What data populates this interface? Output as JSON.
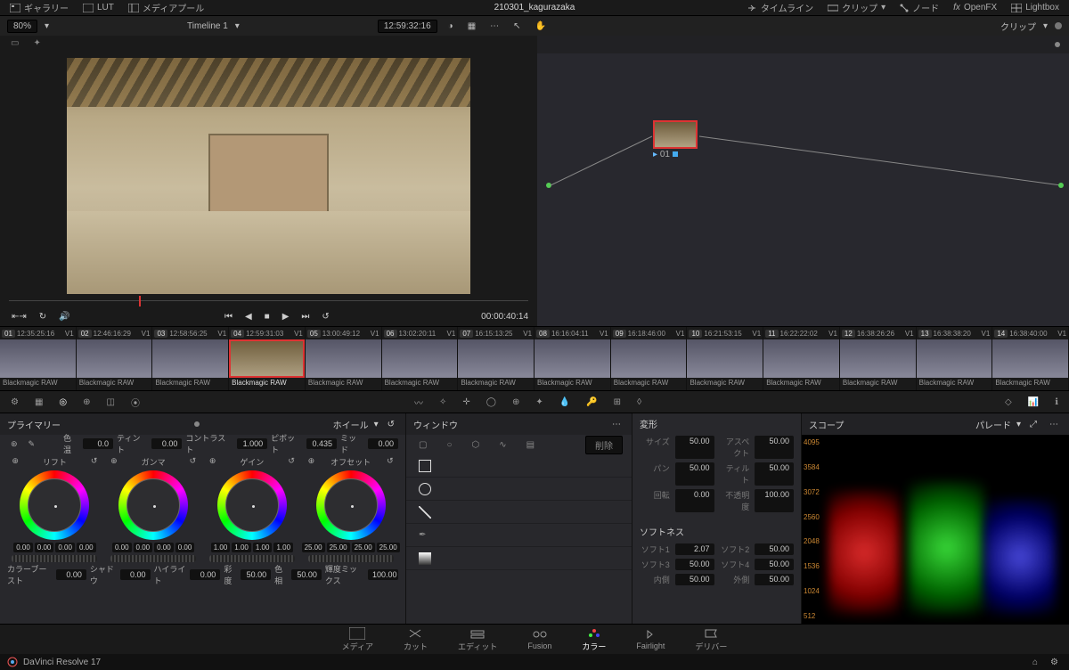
{
  "header": {
    "gallery": "ギャラリー",
    "lut": "LUT",
    "mediapool": "メディアプール",
    "project": "210301_kagurazaka",
    "timeline_btn": "タイムライン",
    "clips": "クリップ",
    "node": "ノード",
    "openfx": "OpenFX",
    "lightbox": "Lightbox"
  },
  "subbar": {
    "zoom": "80%",
    "timeline_name": "Timeline 1",
    "viewer_tc": "12:59:32:16",
    "node_mode": "クリップ"
  },
  "transport": {
    "duration": "00:00:40:14"
  },
  "node": {
    "id": "01"
  },
  "clips": [
    {
      "n": "01",
      "tc": "12:35:25:16",
      "v": "V1"
    },
    {
      "n": "02",
      "tc": "12:46:16:29",
      "v": "V1"
    },
    {
      "n": "03",
      "tc": "12:58:56:25",
      "v": "V1"
    },
    {
      "n": "04",
      "tc": "12:59:31:03",
      "v": "V1"
    },
    {
      "n": "05",
      "tc": "13:00:49:12",
      "v": "V1"
    },
    {
      "n": "06",
      "tc": "13:02:20:11",
      "v": "V1"
    },
    {
      "n": "07",
      "tc": "16:15:13:25",
      "v": "V1"
    },
    {
      "n": "08",
      "tc": "16:16:04:11",
      "v": "V1"
    },
    {
      "n": "09",
      "tc": "16:18:46:00",
      "v": "V1"
    },
    {
      "n": "10",
      "tc": "16:21:53:15",
      "v": "V1"
    },
    {
      "n": "11",
      "tc": "16:22:22:02",
      "v": "V1"
    },
    {
      "n": "12",
      "tc": "16:38:26:26",
      "v": "V1"
    },
    {
      "n": "13",
      "tc": "16:38:38:20",
      "v": "V1"
    },
    {
      "n": "14",
      "tc": "16:38:40:00",
      "v": "V1"
    }
  ],
  "clip_format": "Blackmagic RAW",
  "selected_clip": 3,
  "primaries": {
    "title": "プライマリー",
    "mode": "ホイール",
    "temp_l": "色温",
    "temp": "0.0",
    "tint_l": "ティント",
    "tint": "0.00",
    "contrast_l": "コントラスト",
    "contrast": "1.000",
    "pivot_l": "ピボット",
    "pivot": "0.435",
    "mid_l": "ミッド",
    "mid": "0.00",
    "lift": "リフト",
    "gamma": "ガンマ",
    "gain": "ゲイン",
    "offset": "オフセット",
    "lift_v": [
      "0.00",
      "0.00",
      "0.00",
      "0.00"
    ],
    "gamma_v": [
      "0.00",
      "0.00",
      "0.00",
      "0.00"
    ],
    "gain_v": [
      "1.00",
      "1.00",
      "1.00",
      "1.00"
    ],
    "offset_v": [
      "25.00",
      "25.00",
      "25.00",
      "25.00"
    ],
    "colorboost_l": "カラーブースト",
    "colorboost": "0.00",
    "shadow_l": "シャドウ",
    "shadow": "0.00",
    "highlight_l": "ハイライト",
    "highlight": "0.00",
    "sat_l": "彩度",
    "sat": "50.00",
    "hue_l": "色相",
    "hue": "50.00",
    "lummix_l": "輝度ミックス",
    "lummix": "100.00"
  },
  "window": {
    "title": "ウィンドウ",
    "delete": "削除",
    "transform": "変形",
    "size_l": "サイズ",
    "size": "50.00",
    "aspect_l": "アスペクト",
    "aspect": "50.00",
    "pan_l": "パン",
    "pan": "50.00",
    "tilt_l": "ティルト",
    "tilt": "50.00",
    "rotate_l": "回転",
    "rotate": "0.00",
    "opacity_l": "不透明度",
    "opacity": "100.00",
    "softness": "ソフトネス",
    "soft1_l": "ソフト1",
    "soft1": "2.07",
    "soft2_l": "ソフト2",
    "soft2": "50.00",
    "soft3_l": "ソフト3",
    "soft3": "50.00",
    "soft4_l": "ソフト4",
    "soft4": "50.00",
    "inside_l": "内側",
    "inside": "50.00",
    "outside_l": "外側",
    "outside": "50.00"
  },
  "scopes": {
    "title": "スコープ",
    "mode": "パレード",
    "ticks": [
      "4095",
      "3584",
      "3072",
      "2560",
      "2048",
      "1536",
      "1024",
      "512"
    ]
  },
  "nav": {
    "media": "メディア",
    "cut": "カット",
    "edit": "エディット",
    "fusion": "Fusion",
    "color": "カラー",
    "fairlight": "Fairlight",
    "deliver": "デリバー"
  },
  "footer": {
    "app": "DaVinci Resolve 17"
  }
}
